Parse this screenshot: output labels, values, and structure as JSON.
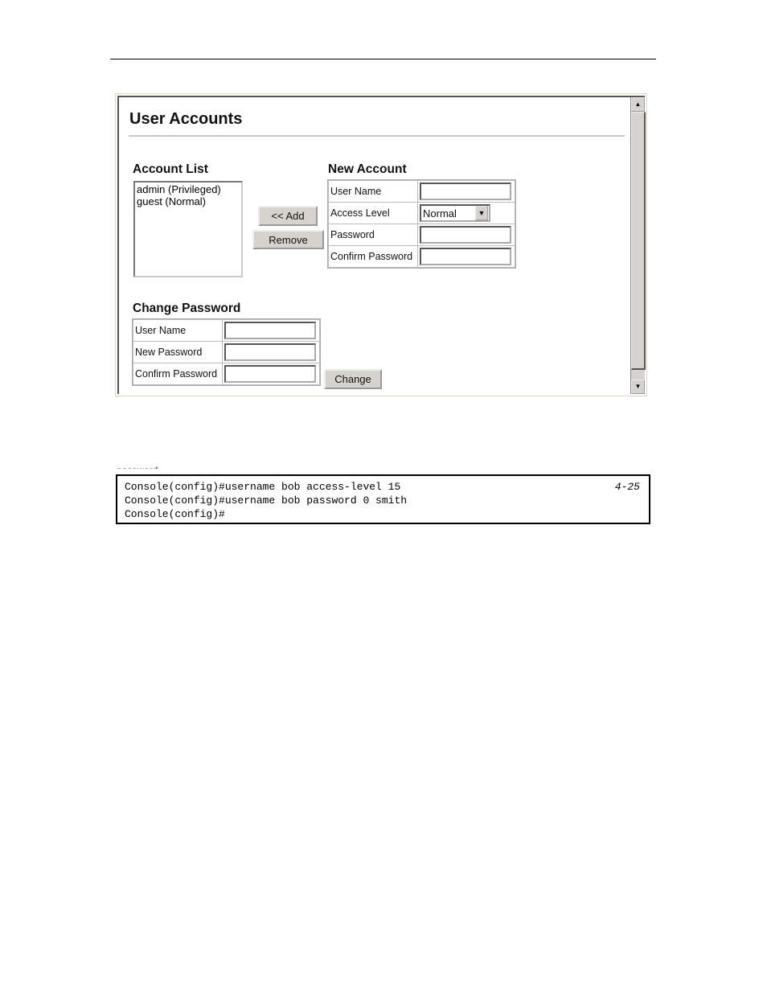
{
  "page": {
    "partial_text": "password."
  },
  "screen": {
    "title": "User Accounts",
    "account_list": {
      "heading": "Account List",
      "items": [
        "admin (Privileged)",
        "guest (Normal)"
      ]
    },
    "buttons": {
      "add": "<< Add",
      "remove": "Remove",
      "change": "Change"
    },
    "new_account": {
      "heading": "New Account",
      "fields": [
        {
          "label": "User Name",
          "value": ""
        },
        {
          "label": "Access Level",
          "value": "Normal"
        },
        {
          "label": "Password",
          "value": ""
        },
        {
          "label": "Confirm Password",
          "value": ""
        }
      ]
    },
    "change_password": {
      "heading": "Change Password",
      "fields": [
        {
          "label": "User Name",
          "value": ""
        },
        {
          "label": "New Password",
          "value": ""
        },
        {
          "label": "Confirm Password",
          "value": ""
        }
      ]
    },
    "icons": {
      "scroll_up": "▲",
      "scroll_down": "▼",
      "dropdown": "▼"
    }
  },
  "code": {
    "lines": [
      "Console(config)#username bob access-level 15",
      "Console(config)#username bob password 0 smith",
      "Console(config)#"
    ],
    "page_ref": "4-25"
  }
}
